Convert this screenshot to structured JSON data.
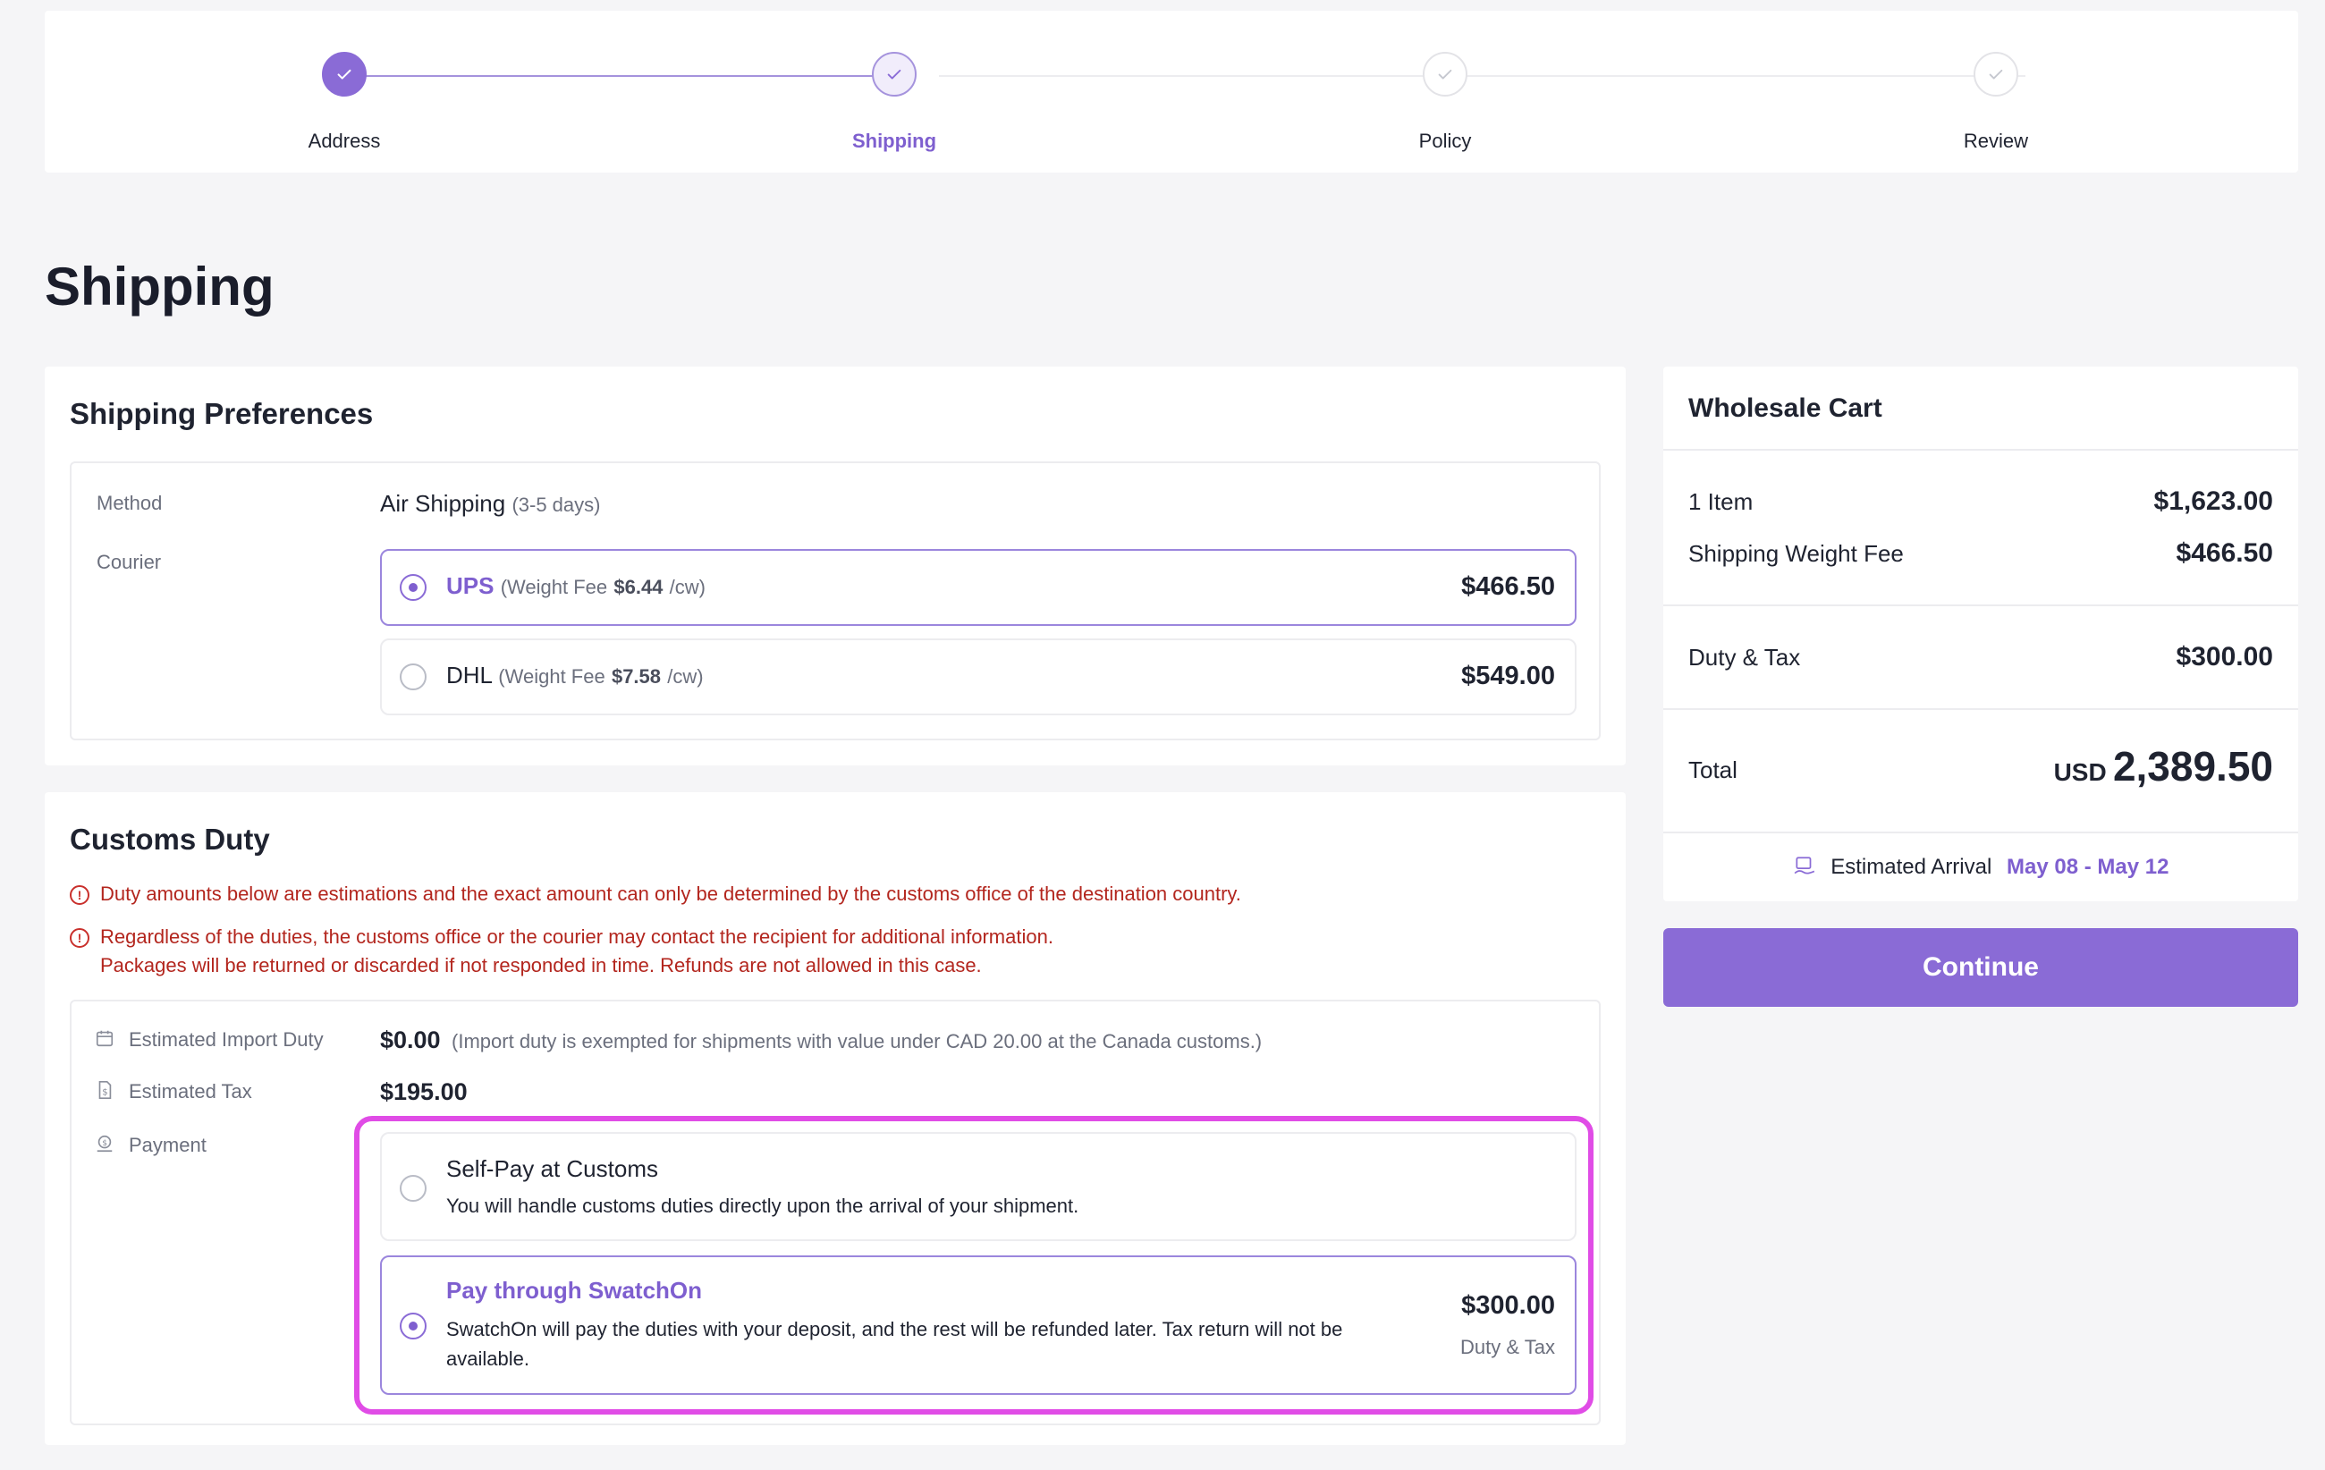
{
  "stepper": {
    "steps": [
      {
        "label": "Address",
        "state": "done"
      },
      {
        "label": "Shipping",
        "state": "current"
      },
      {
        "label": "Policy",
        "state": "todo"
      },
      {
        "label": "Review",
        "state": "todo"
      }
    ]
  },
  "page_title": "Shipping",
  "shipping_preferences": {
    "title": "Shipping Preferences",
    "method_label": "Method",
    "method_value": "Air Shipping",
    "method_days": "(3-5 days)",
    "courier_label": "Courier",
    "couriers": [
      {
        "name": "UPS",
        "fee_prefix": "(Weight Fee",
        "fee": "$6.44",
        "fee_suffix": "/cw)",
        "price": "$466.50",
        "selected": true
      },
      {
        "name": "DHL",
        "fee_prefix": "(Weight Fee",
        "fee": "$7.58",
        "fee_suffix": "/cw)",
        "price": "$549.00",
        "selected": false
      }
    ]
  },
  "customs": {
    "title": "Customs Duty",
    "warnings": [
      "Duty amounts below are estimations and the exact amount can only be determined by the customs office of the destination country.",
      "Regardless of the duties, the customs office or the courier may contact the recipient for additional information.",
      "Packages will be returned or discarded if not responded in time. Refunds are not allowed in this case."
    ],
    "import_duty_label": "Estimated Import Duty",
    "import_duty_value": "$0.00",
    "import_duty_note": "(Import duty is exempted for shipments with value under CAD 20.00 at the Canada customs.)",
    "tax_label": "Estimated Tax",
    "tax_value": "$195.00",
    "payment_label": "Payment",
    "payment_options": [
      {
        "title": "Self-Pay at Customs",
        "desc": "You will handle customs duties directly upon the arrival of your shipment.",
        "selected": false
      },
      {
        "title": "Pay through SwatchOn",
        "desc_line1": "SwatchOn will pay the duties with your deposit, and the rest will be refunded later. Tax return will not be",
        "desc_line2": "available.",
        "price": "$300.00",
        "price_sub": "Duty & Tax",
        "selected": true
      }
    ]
  },
  "cart": {
    "title": "Wholesale Cart",
    "item_label": "1 Item",
    "item_value": "$1,623.00",
    "weight_label": "Shipping Weight Fee",
    "weight_value": "$466.50",
    "duty_label": "Duty & Tax",
    "duty_value": "$300.00",
    "total_label": "Total",
    "total_currency": "USD",
    "total_value": "2,389.50",
    "arrival_label": "Estimated Arrival",
    "arrival_value": "May 08 - May 12"
  },
  "continue_label": "Continue",
  "colors": {
    "accent": "#8a6bd6",
    "warning": "#b3261e",
    "highlight": "#e04ce6"
  }
}
